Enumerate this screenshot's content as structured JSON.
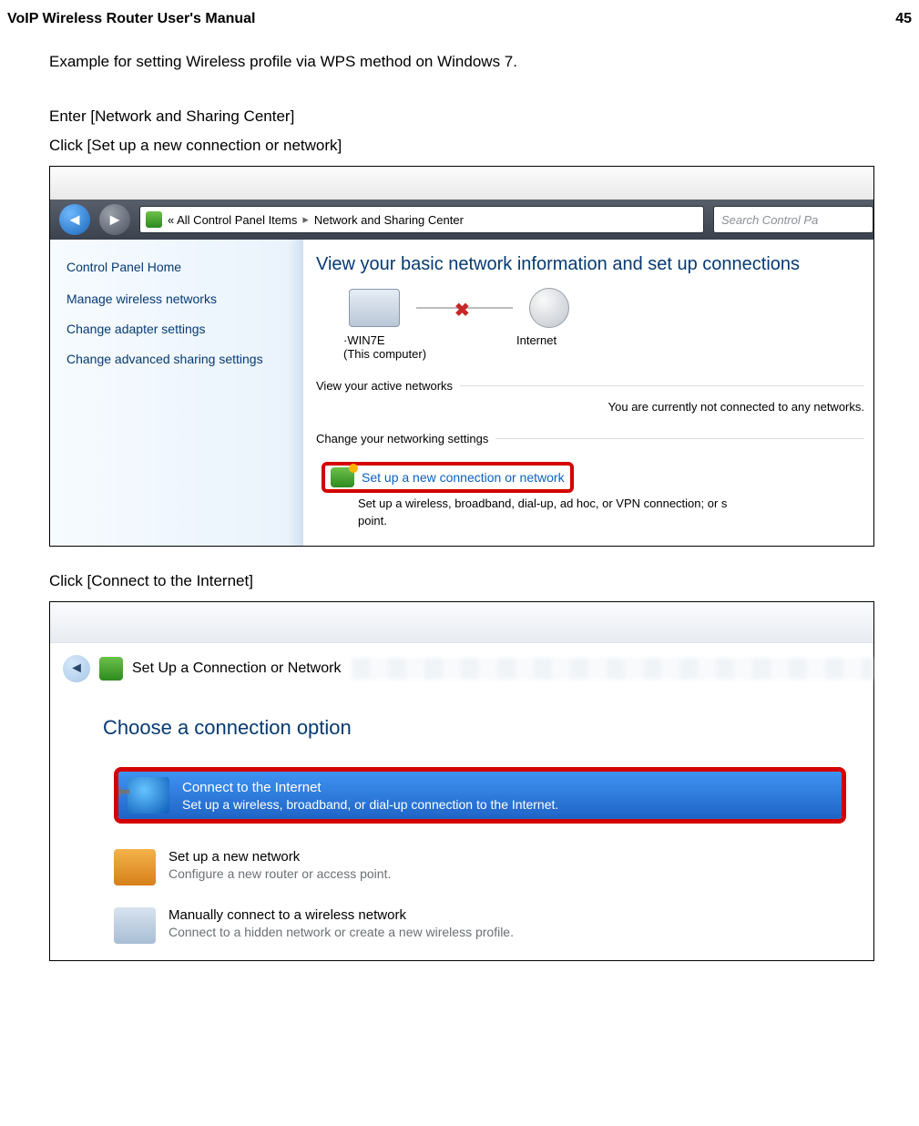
{
  "header": {
    "left": "VoIP Wireless Router User's Manual",
    "right": "45"
  },
  "intro": "Example for setting Wireless profile via WPS method on Windows 7.",
  "step1a": "Enter [Network and Sharing Center]",
  "step1b": "Click [Set up a new connection or network]",
  "step2": "Click [Connect to the Internet]",
  "shot1": {
    "breadcrumb_prefix": "«  All Control Panel Items",
    "breadcrumb_sep": "▸",
    "breadcrumb_current": "Network and Sharing Center",
    "search_placeholder": "Search Control Pa",
    "side_home": "Control Panel Home",
    "side_link1": "Manage wireless networks",
    "side_link2": "Change adapter settings",
    "side_link3": "Change advanced sharing settings",
    "title": "View your basic network information and set up connections",
    "pc_name": "·WIN7E",
    "pc_sub": "(This computer)",
    "internet_label": "Internet",
    "active_section": "View your active networks",
    "active_msg": "You are currently not connected to any networks.",
    "change_section": "Change your networking settings",
    "change_link": "Set up a new connection or network",
    "change_sub": "Set up a wireless, broadband, dial-up, ad hoc, or VPN connection; or s",
    "change_sub2": "point."
  },
  "shot2": {
    "bar_title": "Set Up a Connection or Network",
    "title": "Choose a connection option",
    "opt1_t1": "Connect to the Internet",
    "opt1_t2": "Set up a wireless, broadband, or dial-up connection to the Internet.",
    "opt2_t1": "Set up a new network",
    "opt2_t2": "Configure a new router or access point.",
    "opt3_t1": "Manually connect to a wireless network",
    "opt3_t2": "Connect to a hidden network or create a new wireless profile."
  }
}
